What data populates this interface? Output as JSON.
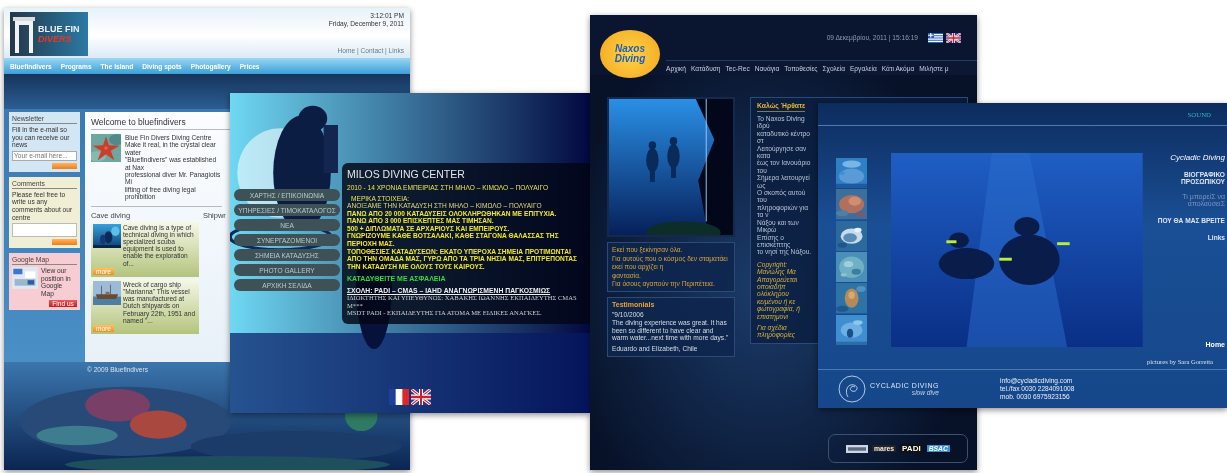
{
  "bluefin": {
    "logo": [
      "BLUE FIN",
      "DIVERS"
    ],
    "time": "3:12:01 PM",
    "date": "Friday, December 9, 2011",
    "top_links": "Home | Contact | Links",
    "nav": [
      "Bluefindivers",
      "Programs",
      "The Island",
      "Diving spots",
      "Photogallery",
      "Prices"
    ],
    "newsletter": {
      "title": "Newsletter",
      "text": "Fill in the e-mail so you can receive our news",
      "placeholder": "Your e-mail here..."
    },
    "comments": {
      "title": "Comments",
      "text": "Please feel free to write us any comments about our centre"
    },
    "map": {
      "title": "Google Map",
      "text": "View our position in Google Map",
      "button": "Find us"
    },
    "welcome": {
      "title": "Welcome to bluefindivers",
      "lines": [
        "Blue Fin Divers Diving Centre",
        "Make it real, in the crystal clear water",
        "\"Bluefindivers\" was established at Nax",
        "professional diver Mr. Panagiotis Mi",
        "lifting of free diving legal prohibition"
      ]
    },
    "sections": [
      "Cave diving",
      "Shipwr"
    ],
    "articles": [
      {
        "text": "Cave diving is a type of technical diving in which specialized scuba equipment is used to enable the exploration of...",
        "button": "more"
      },
      {
        "text": "Wreck of cargo ship \"Marianna\" This vessel was manufactured at Dutch shipyards on February 22th, 1951 and named \"...",
        "button": "more"
      }
    ],
    "copyright": "© 2009 Bluefindivers"
  },
  "milos": {
    "menu": [
      "ΧΑΡΤΗΣ / ΕΠΙΚΟΙΝΩΝΙΑ",
      "ΥΠΗΡΕΣΙΕΣ / ΤΙΜΟΚΑΤΑΛΟΓΟΣ",
      "ΝΕΑ",
      "ΣΥΝΕΡΓΑΖΟΜΕΝΟΙ",
      "ΣΗΜΕΙΑ ΚΑΤΑΔΥΣΗΣ",
      "PHOTO GALLERY",
      "ΑΡΧΙΚΗ ΣΕΛΙΔΑ"
    ],
    "title": "MILOS DIVING CENTER",
    "subtitle": "2010 - 14 ΧΡΟΝΙΑ ΕΜΠΕΙΡΙΑΣ ΣΤΗ ΜΗΛΟ – ΚΙΜΩΛΟ – ΠΟΛΥΑΙΓΟ",
    "stats_heading": "ΜΕΡΙΚΑ ΣΤΟΙΧΕΙΑ:",
    "stats": [
      "ΑΝΟΙΞΑΜΕ ΤΗΝ ΚΑΤΑΔΥΣΗ ΣΤΗ ΜΗΛΟ – ΚΙΜΩΛΟ – ΠΟΛΥΑΙΓΟ",
      "ΠΑΝΩ ΑΠΟ 20 000 ΚΑΤΑΔΥΣΕΙΣ ΟΛΟΚΛΗΡΩΘΗΚΑΝ ΜΕ ΕΠΙΤΥΧΙΑ.",
      "ΠΑΝΩ ΑΠΟ 3 000 ΕΠΙΣΚΕΠΤΕΣ ΜΑΣ ΤΙΜΗΣΑΝ.",
      "500 + ΔΙΠΛΩΜΑΤΑ ΣΕ ΑΡΧΑΡΙΟΥΣ ΚΑΙ ΕΜΠΕΙΡΟΥΣ.",
      "ΓΝΩΡΙΖΟΥΜΕ ΚΑΘΕ ΒΟΤΣΑΛΑΚΙ, ΚΑΘΕ ΣΤΑΓΟΝΑ ΘΑΛΑΣΣΑΣ ΤΗΣ ΠΕΡΙΟΧΗ ΜΑΣ.",
      "ΤΟΠΟΘΕΣΙΕΣ ΚΑΤΑΔΥΣΕΩΝ: ΕΚΑΤΟ ΥΠΕΡΟΧΑ ΣΗΜΕΙΑ ΠΡΟΤΙΜΩΝΤΑΙ ΑΠΟ ΤΗΝ ΟΜΑΔΑ ΜΑΣ, ΓΥΡΩ ΑΠΟ ΤΑ ΤΡΙΑ ΝΗΣΙΑ ΜΑΣ, ΕΠΙΤΡΕΠΟΝΤΑΣ ΤΗΝ ΚΑΤΑΔΥΣΗ ΜΕ ΟΛΟΥΣ ΤΟΥΣ ΚΑΙΡΟΥΣ."
    ],
    "safety": "ΚΑΤΑΔΥΘΕΙΤΕ ΜΕ ΑΣΦΑΛΕΙΑ",
    "school": "ΣΧΟΛΗ: PADI – CMAS – IAHD ΑΝΑΓΝΩΡΙΣΜΕΝΗ ΠΑΓΚΟΣΜΙΩΣ",
    "owner": [
      "ΙΔΙΟΚΤΗΤΗΣ ΚΑΙ ΥΠΕΥΘΥΝΟΣ: ΧΑΒΑΚΗΣ ΙΩΑΝΝΗΣ ΕΚΠΑΙΔΕΥΤΗΣ CMAS M***",
      "MSDT PADI - ΕΚΠΑΙΔΕΥΤΗΣ ΓΙΑ ΑΤΟΜΑ ΜΕ ΕΙΔΙΚΕΣ ΑΝΑΓΚΕΣ."
    ]
  },
  "naxos": {
    "logo": [
      "Naxos",
      "Diving"
    ],
    "date": "09 Δεκεμβρίου, 2011 | 15:16:19",
    "nav": [
      "Αρχική",
      "Κατάδυση",
      "Tec-Rec",
      "Ναυάγια",
      "Τοποθεσίες",
      "Σχολεία",
      "Εργαλεία",
      "Κάτι Ακόμα",
      "Μιλήστε μ"
    ],
    "welcome_title": "Καλώς Ήρθατε",
    "welcome_lines": [
      "Το Naxos Diving ιδρύ",
      "καταδυτικό κέντρο στ",
      "Λειτούργησε σαν κατα",
      "έως τον Ιανουάριο του",
      "Σήμερα λειτουργεί ως",
      "Ο σκοπός αυτού του",
      "πληροφοριών για τα ν",
      "Νάξου και των Μικρώ",
      "Επίσης ο επισκέπτης",
      "το νησί της Νάξου."
    ],
    "copyright_lines": [
      "Copyright: Μανώλης Μα",
      "Απαγορεύεται οποιαδήπ",
      "ολόκληρου κειμένου ή κε",
      "φωτογραφία, ή επιστημονι"
    ],
    "info_line": "Για σχέδια πληροφορίες",
    "slogan_lines": [
      "Εκεί που ξεκίνησαν όλα.",
      "Για αυτούς που ο κόσμος δεν σταματάει",
      "εκεί που αρχίζει η",
      "φαντασία.",
      "Για όσους αγαπούν την Περιπέτεια."
    ],
    "testimonials": {
      "title": "Testimonials",
      "date": "\"9/10/2006",
      "quote": "The diving experience was great. It has been so different to have clear and warm water...next time with more days.\"",
      "author": "Eduardo and Elizabeth, Chile"
    },
    "sponsors": [
      "mares",
      "PADI",
      "BSAC"
    ]
  },
  "cycladic": {
    "sound": "SOUND",
    "title": "Cycladic Diving",
    "menu": [
      {
        "label": "ΒΙΟΓΡΑΦΙΚΟ ΠΡΟΣΩΠΙΚΟΥ",
        "selected": false
      },
      {
        "label": "Τι μπορείΣ να απολαύσειΣ",
        "selected": true
      },
      {
        "label": "ΠΟΥ ΘΑ ΜΑΣ ΒΡΕΙΤΕ",
        "selected": false
      },
      {
        "label": "Links",
        "selected": false
      }
    ],
    "home": "Home",
    "credit": "pictures by Sara Gorretta",
    "logo": [
      "CYCLADIC DIVING",
      "slow dive"
    ],
    "contacts": [
      "info@cycladicdiving.com",
      "tel./fax 0030 2284091008",
      "mob. 0030 6975923156"
    ]
  }
}
